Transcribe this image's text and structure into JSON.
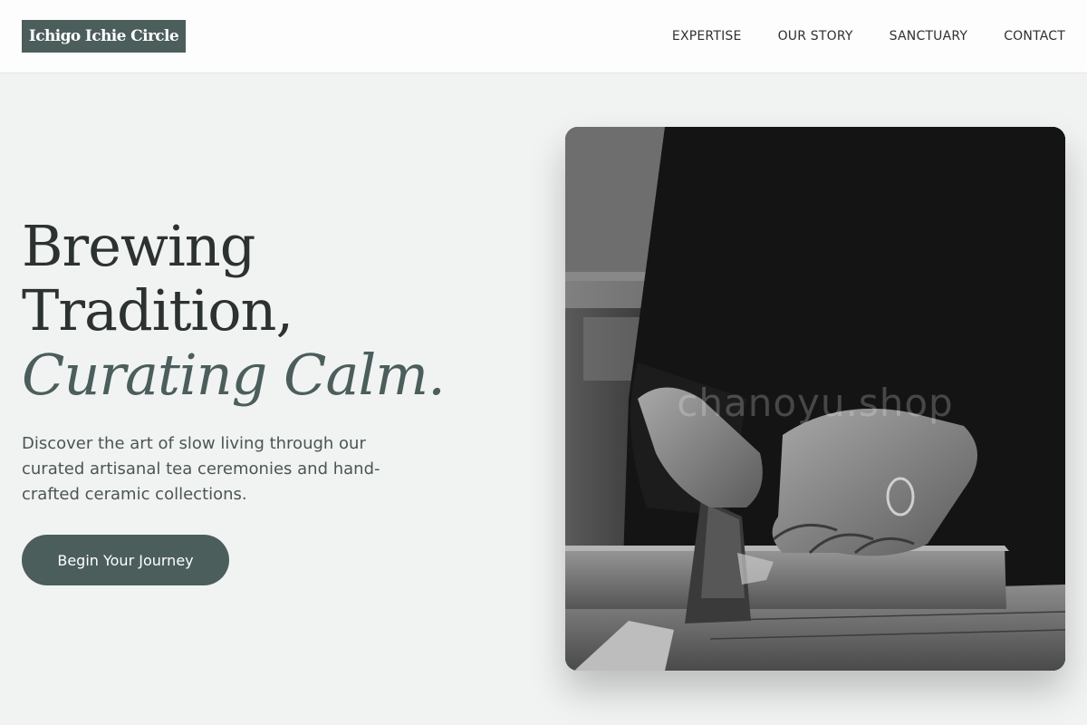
{
  "brand": {
    "name": "Ichigo Ichie Circle"
  },
  "nav": {
    "items": [
      {
        "label": "EXPERTISE"
      },
      {
        "label": "OUR STORY"
      },
      {
        "label": "SANCTUARY"
      },
      {
        "label": "CONTACT"
      }
    ]
  },
  "hero": {
    "headline_line1": "Brewing",
    "headline_line2": "Tradition,",
    "headline_accent": "Curating Calm.",
    "subtitle": "Discover the art of slow living through our curated artisanal tea ceremonies and hand-crafted ceramic collections.",
    "cta_label": "Begin Your Journey",
    "image_watermark": "chanoyu.shop"
  },
  "colors": {
    "accent": "#4b5e5c",
    "background": "#f1f3f2",
    "header_background": "#fdfdfd",
    "text": "#2c3230"
  }
}
